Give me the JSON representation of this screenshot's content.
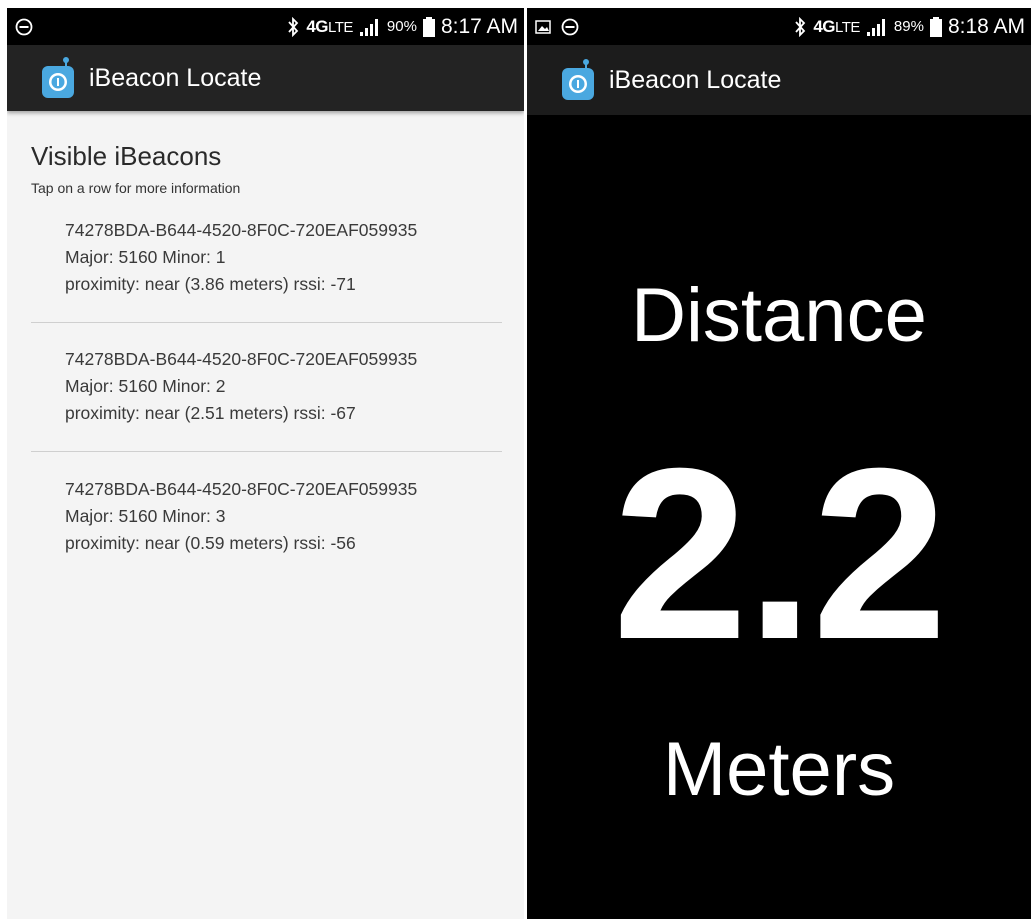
{
  "left": {
    "status": {
      "network": "4G",
      "network_sub": "LTE",
      "battery": "90%",
      "time": "8:17 AM"
    },
    "app_title": "iBeacon Locate",
    "heading": "Visible iBeacons",
    "subheading": "Tap on a row for more information",
    "beacons": [
      {
        "uuid": "74278BDA-B644-4520-8F0C-720EAF059935",
        "major_minor": "Major: 5160   Minor: 1",
        "proximity": "proximity: near   (3.86 meters)   rssi: -71"
      },
      {
        "uuid": "74278BDA-B644-4520-8F0C-720EAF059935",
        "major_minor": "Major: 5160   Minor: 2",
        "proximity": "proximity: near   (2.51 meters)   rssi: -67"
      },
      {
        "uuid": "74278BDA-B644-4520-8F0C-720EAF059935",
        "major_minor": "Major: 5160   Minor: 3",
        "proximity": "proximity: near   (0.59 meters)   rssi: -56"
      }
    ]
  },
  "right": {
    "status": {
      "network": "4G",
      "network_sub": "LTE",
      "battery": "89%",
      "time": "8:18 AM"
    },
    "app_title": "iBeacon Locate",
    "distance_label": "Distance",
    "distance_value": "2.2",
    "distance_unit": "Meters"
  },
  "icons": [
    "do-not-disturb-icon",
    "bluetooth-icon",
    "signal-icon",
    "battery-icon",
    "gallery-icon",
    "app-icon"
  ]
}
